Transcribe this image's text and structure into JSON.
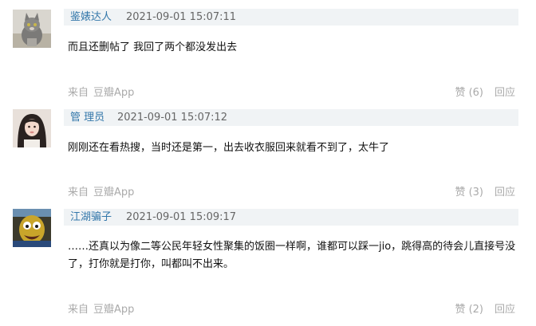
{
  "comments": [
    {
      "author": "鉴婊达人",
      "time": "2021-09-01 15:07:11",
      "text": "而且还删帖了 我回了两个都没发出去",
      "source_prefix": "来自",
      "source_app": "豆瓣App",
      "vote": "赞 (6)",
      "reply": "回应"
    },
    {
      "author": "管 理员",
      "time": "2021-09-01 15:07:12",
      "text": "刚刚还在看热搜，当时还是第一，出去收衣服回来就看不到了，太牛了",
      "source_prefix": "来自",
      "source_app": "豆瓣App",
      "vote": "赞 (3)",
      "reply": "回应"
    },
    {
      "author": "江湖骗子",
      "time": "2021-09-01 15:09:17",
      "text": "……还真以为像二等公民年轻女性聚集的饭圈一样啊，谁都可以踩一jio，跳得高的待会儿直接号没了，打你就是打你，叫都叫不出来。",
      "source_prefix": "来自",
      "source_app": "豆瓣App",
      "vote": "赞 (2)",
      "reply": "回应"
    }
  ]
}
